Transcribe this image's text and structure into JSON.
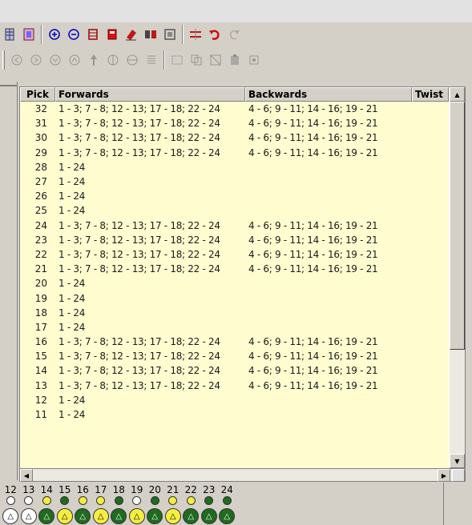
{
  "grid": {
    "headers": {
      "pick": "Pick",
      "forwards": "Forwards",
      "backwards": "Backwards",
      "twist": "Twist"
    },
    "rows": [
      {
        "pick": "32",
        "forwards": "1 - 3; 7 - 8; 12 - 13; 17 - 18; 22 - 24",
        "backwards": "4 - 6; 9 - 11; 14 - 16; 19 - 21"
      },
      {
        "pick": "31",
        "forwards": "1 - 3; 7 - 8; 12 - 13; 17 - 18; 22 - 24",
        "backwards": "4 - 6; 9 - 11; 14 - 16; 19 - 21"
      },
      {
        "pick": "30",
        "forwards": "1 - 3; 7 - 8; 12 - 13; 17 - 18; 22 - 24",
        "backwards": "4 - 6; 9 - 11; 14 - 16; 19 - 21"
      },
      {
        "pick": "29",
        "forwards": "1 - 3; 7 - 8; 12 - 13; 17 - 18; 22 - 24",
        "backwards": "4 - 6; 9 - 11; 14 - 16; 19 - 21"
      },
      {
        "pick": "28",
        "forwards": "1 - 24",
        "backwards": ""
      },
      {
        "pick": "27",
        "forwards": "1 - 24",
        "backwards": ""
      },
      {
        "pick": "26",
        "forwards": "1 - 24",
        "backwards": ""
      },
      {
        "pick": "25",
        "forwards": "1 - 24",
        "backwards": ""
      },
      {
        "pick": "24",
        "forwards": "1 - 3; 7 - 8; 12 - 13; 17 - 18; 22 - 24",
        "backwards": "4 - 6; 9 - 11; 14 - 16; 19 - 21"
      },
      {
        "pick": "23",
        "forwards": "1 - 3; 7 - 8; 12 - 13; 17 - 18; 22 - 24",
        "backwards": "4 - 6; 9 - 11; 14 - 16; 19 - 21"
      },
      {
        "pick": "22",
        "forwards": "1 - 3; 7 - 8; 12 - 13; 17 - 18; 22 - 24",
        "backwards": "4 - 6; 9 - 11; 14 - 16; 19 - 21"
      },
      {
        "pick": "21",
        "forwards": "1 - 3; 7 - 8; 12 - 13; 17 - 18; 22 - 24",
        "backwards": "4 - 6; 9 - 11; 14 - 16; 19 - 21"
      },
      {
        "pick": "20",
        "forwards": "1 - 24",
        "backwards": ""
      },
      {
        "pick": "19",
        "forwards": "1 - 24",
        "backwards": ""
      },
      {
        "pick": "18",
        "forwards": "1 - 24",
        "backwards": ""
      },
      {
        "pick": "17",
        "forwards": "1 - 24",
        "backwards": ""
      },
      {
        "pick": "16",
        "forwards": "1 - 3; 7 - 8; 12 - 13; 17 - 18; 22 - 24",
        "backwards": "4 - 6; 9 - 11; 14 - 16; 19 - 21"
      },
      {
        "pick": "15",
        "forwards": "1 - 3; 7 - 8; 12 - 13; 17 - 18; 22 - 24",
        "backwards": "4 - 6; 9 - 11; 14 - 16; 19 - 21"
      },
      {
        "pick": "14",
        "forwards": "1 - 3; 7 - 8; 12 - 13; 17 - 18; 22 - 24",
        "backwards": "4 - 6; 9 - 11; 14 - 16; 19 - 21"
      },
      {
        "pick": "13",
        "forwards": "1 - 3; 7 - 8; 12 - 13; 17 - 18; 22 - 24",
        "backwards": "4 - 6; 9 - 11; 14 - 16; 19 - 21"
      },
      {
        "pick": "12",
        "forwards": "1 - 24",
        "backwards": ""
      },
      {
        "pick": "11",
        "forwards": "1 - 24",
        "backwards": ""
      }
    ]
  },
  "cards": {
    "numbers": [
      "12",
      "13",
      "14",
      "15",
      "16",
      "17",
      "18",
      "19",
      "20",
      "21",
      "22",
      "23",
      "24"
    ],
    "top_dots": [
      "white",
      "white",
      "yellow",
      "green",
      "yellow",
      "yellow",
      "green",
      "white",
      "green",
      "yellow",
      "yellow",
      "green",
      "green"
    ],
    "bottom_marks": [
      "white",
      "white",
      "green",
      "yellow",
      "green",
      "yellow",
      "green",
      "yellow",
      "green",
      "yellow",
      "green",
      "green",
      "green"
    ],
    "colors": {
      "white": "#ffffff",
      "yellow": "#f4ee40",
      "green": "#1f6b1f"
    }
  },
  "icons": {
    "toolbar1": [
      "grid-icon",
      "grid-color-icon",
      "zoom-in-icon",
      "zoom-out-icon",
      "card-icon",
      "card-red-icon",
      "erase-icon",
      "pattern-icon",
      "frame-icon",
      "threading-icon",
      "undo-icon",
      "redo-icon"
    ],
    "toolbar2": [
      "rotate-left-icon",
      "rotate-right-icon",
      "rotate-cw-icon",
      "rotate-ccw-icon",
      "flip-icon",
      "mirror-v-icon",
      "mirror-h-icon",
      "list-icon",
      "select-icon",
      "copy-icon",
      "cut-icon",
      "paste-icon",
      "settings-icon"
    ]
  },
  "scroll": {
    "up": "▲",
    "down": "▼",
    "left": "◀",
    "right": "▶"
  }
}
